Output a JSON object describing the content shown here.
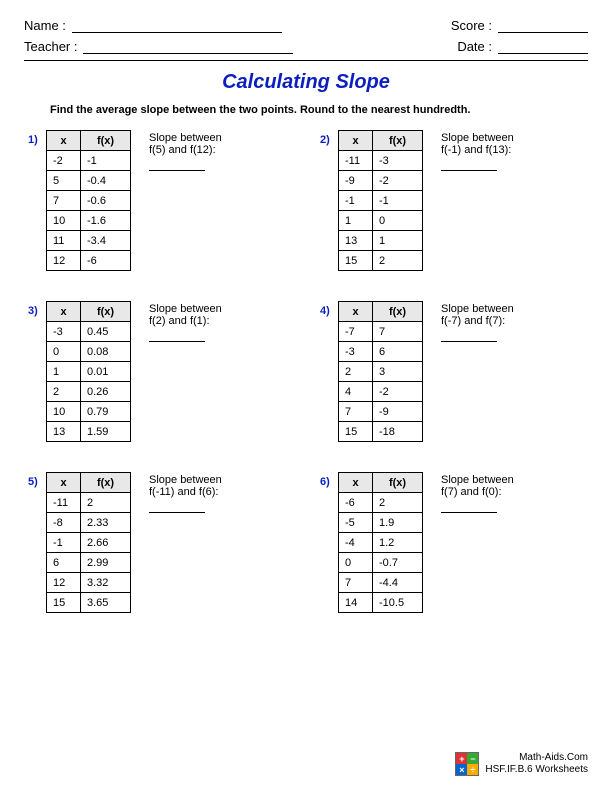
{
  "header": {
    "name_label": "Name :",
    "teacher_label": "Teacher :",
    "score_label": "Score :",
    "date_label": "Date :"
  },
  "title": "Calculating Slope",
  "instructions": "Find the average slope between the two points. Round to the nearest hundredth.",
  "col_headers": {
    "x": "x",
    "fx": "f(x)"
  },
  "slope_between_label": "Slope between",
  "problems": [
    {
      "num": "1)",
      "points_text": "f(5) and f(12):",
      "rows": [
        {
          "x": "-2",
          "fx": "-1"
        },
        {
          "x": "5",
          "fx": "-0.4"
        },
        {
          "x": "7",
          "fx": "-0.6"
        },
        {
          "x": "10",
          "fx": "-1.6"
        },
        {
          "x": "11",
          "fx": "-3.4"
        },
        {
          "x": "12",
          "fx": "-6"
        }
      ]
    },
    {
      "num": "2)",
      "points_text": "f(-1) and f(13):",
      "rows": [
        {
          "x": "-11",
          "fx": "-3"
        },
        {
          "x": "-9",
          "fx": "-2"
        },
        {
          "x": "-1",
          "fx": "-1"
        },
        {
          "x": "1",
          "fx": "0"
        },
        {
          "x": "13",
          "fx": "1"
        },
        {
          "x": "15",
          "fx": "2"
        }
      ]
    },
    {
      "num": "3)",
      "points_text": "f(2) and f(1):",
      "rows": [
        {
          "x": "-3",
          "fx": "0.45"
        },
        {
          "x": "0",
          "fx": "0.08"
        },
        {
          "x": "1",
          "fx": "0.01"
        },
        {
          "x": "2",
          "fx": "0.26"
        },
        {
          "x": "10",
          "fx": "0.79"
        },
        {
          "x": "13",
          "fx": "1.59"
        }
      ]
    },
    {
      "num": "4)",
      "points_text": "f(-7) and f(7):",
      "rows": [
        {
          "x": "-7",
          "fx": "7"
        },
        {
          "x": "-3",
          "fx": "6"
        },
        {
          "x": "2",
          "fx": "3"
        },
        {
          "x": "4",
          "fx": "-2"
        },
        {
          "x": "7",
          "fx": "-9"
        },
        {
          "x": "15",
          "fx": "-18"
        }
      ]
    },
    {
      "num": "5)",
      "points_text": "f(-11) and f(6):",
      "rows": [
        {
          "x": "-11",
          "fx": "2"
        },
        {
          "x": "-8",
          "fx": "2.33"
        },
        {
          "x": "-1",
          "fx": "2.66"
        },
        {
          "x": "6",
          "fx": "2.99"
        },
        {
          "x": "12",
          "fx": "3.32"
        },
        {
          "x": "15",
          "fx": "3.65"
        }
      ]
    },
    {
      "num": "6)",
      "points_text": "f(7) and f(0):",
      "rows": [
        {
          "x": "-6",
          "fx": "2"
        },
        {
          "x": "-5",
          "fx": "1.9"
        },
        {
          "x": "-4",
          "fx": "1.2"
        },
        {
          "x": "0",
          "fx": "-0.7"
        },
        {
          "x": "7",
          "fx": "-4.4"
        },
        {
          "x": "14",
          "fx": "-10.5"
        }
      ]
    }
  ],
  "footer": {
    "site": "Math-Aids.Com",
    "standard": "HSF.IF.B.6 Worksheets"
  }
}
